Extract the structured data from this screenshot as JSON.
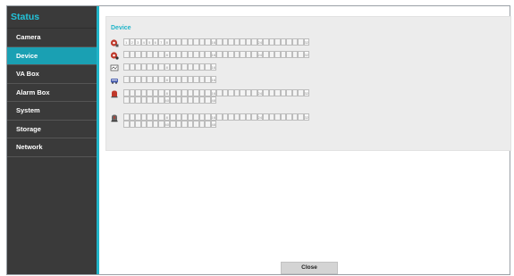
{
  "sidebar": {
    "title": "Status",
    "items": [
      {
        "label": "Camera",
        "active": false
      },
      {
        "label": "Device",
        "active": true
      },
      {
        "label": "VA Box",
        "active": false
      },
      {
        "label": "Alarm Box",
        "active": false
      },
      {
        "label": "System",
        "active": false
      },
      {
        "label": "Storage",
        "active": false
      },
      {
        "label": "Network",
        "active": false
      }
    ]
  },
  "panel": {
    "title": "Device",
    "rows": [
      {
        "icon": "camera-alarm-icon",
        "cells": [
          "1",
          "2",
          "3",
          "4",
          "5",
          "6",
          "7",
          "8",
          "",
          "",
          "",
          "",
          "",
          "",
          "",
          "16",
          "",
          "",
          "",
          "",
          "",
          "",
          "",
          "24",
          "",
          "",
          "",
          "",
          "",
          "",
          "",
          "32"
        ]
      },
      {
        "icon": "camera-record-icon",
        "cells": [
          "",
          "",
          "",
          "",
          "",
          "",
          "",
          "8",
          "",
          "",
          "",
          "",
          "",
          "",
          "",
          "16",
          "",
          "",
          "",
          "",
          "",
          "",
          "",
          "24",
          "",
          "",
          "",
          "",
          "",
          "",
          "",
          "32"
        ]
      },
      {
        "icon": "monitor-icon",
        "cells": [
          "",
          "",
          "",
          "",
          "",
          "",
          "",
          "8",
          "",
          "",
          "",
          "",
          "",
          "",
          "",
          "16"
        ]
      },
      {
        "icon": "vehicle-icon",
        "cells": [
          "",
          "",
          "",
          "",
          "",
          "",
          "",
          "8",
          "",
          "",
          "",
          "",
          "",
          "",
          "",
          "16"
        ]
      },
      {
        "icon": "alarm-in-icon",
        "cells": [
          "",
          "",
          "",
          "",
          "",
          "",
          "",
          "8",
          "",
          "",
          "",
          "",
          "",
          "",
          "",
          "16",
          "",
          "",
          "",
          "",
          "",
          "",
          "",
          "24",
          "",
          "",
          "",
          "",
          "",
          "",
          "",
          "32"
        ],
        "cells2": [
          "",
          "",
          "",
          "",
          "",
          "",
          "",
          "40",
          "",
          "",
          "",
          "",
          "",
          "",
          "",
          "48"
        ]
      },
      {
        "icon": "alarm-out-icon",
        "cells": [
          "",
          "",
          "",
          "",
          "",
          "",
          "",
          "8",
          "",
          "",
          "",
          "",
          "",
          "",
          "",
          "16",
          "",
          "",
          "",
          "",
          "",
          "",
          "",
          "24",
          "",
          "",
          "",
          "",
          "",
          "",
          "",
          "32"
        ],
        "cells2": [
          "",
          "",
          "",
          "",
          "",
          "",
          "",
          "40",
          "",
          "",
          "",
          "",
          "",
          "",
          "",
          "48"
        ]
      }
    ]
  },
  "buttons": {
    "close": "Close"
  },
  "colors": {
    "accent": "#21b5c9",
    "sidebar_bg": "#3a3a3a",
    "active_bg": "#1aa0b3"
  }
}
